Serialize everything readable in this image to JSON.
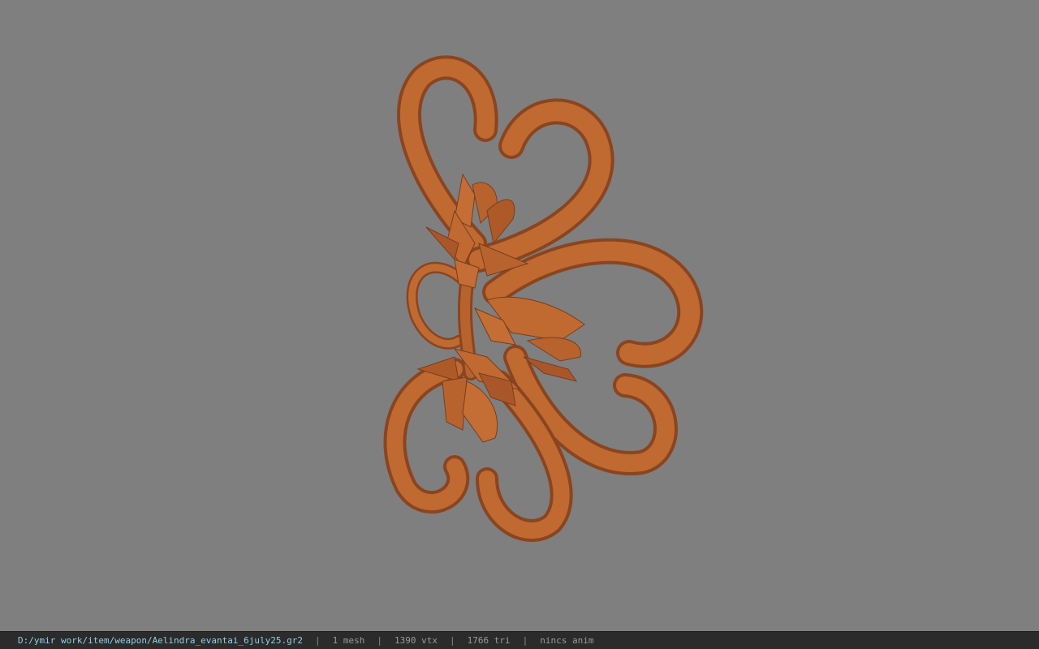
{
  "viewer": {
    "background_color": "#7f7f7f",
    "model_color": "#b8632e"
  },
  "status_bar": {
    "file_path": "D:/ymir work/item/weapon/Aelindra_evantai_6july25.gr2",
    "separator": "|",
    "mesh_count": "1 mesh",
    "vertex_count": "1390 vtx",
    "triangle_count": "1766 tri",
    "animation": "nincs anim"
  }
}
